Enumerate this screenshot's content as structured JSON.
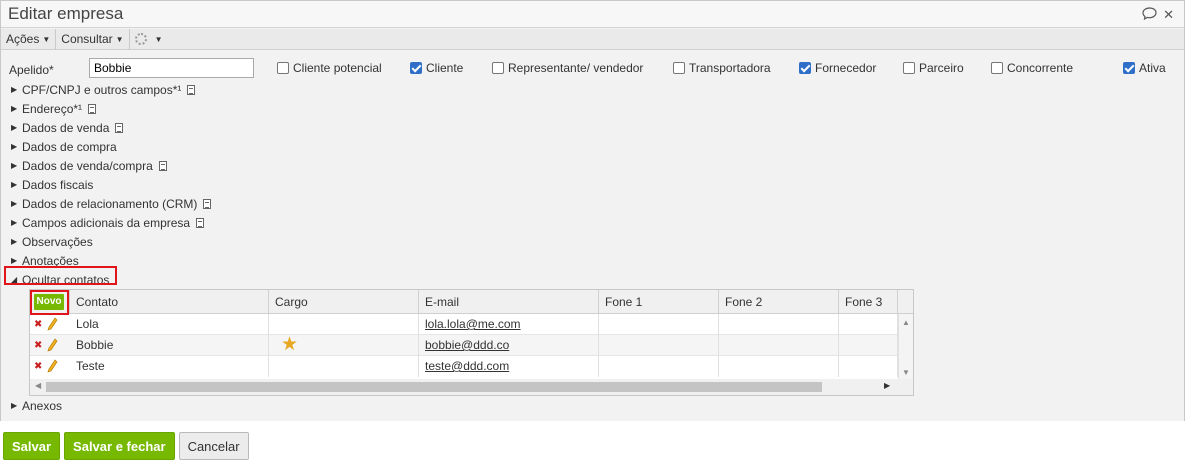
{
  "window": {
    "title": "Editar empresa"
  },
  "toolbar": {
    "acoes": "Ações",
    "consultar": "Consultar"
  },
  "form": {
    "apelido_label": "Apelido*",
    "apelido_value": "Bobbie",
    "checkboxes": [
      {
        "label": "Cliente potencial",
        "checked": false
      },
      {
        "label": "Cliente",
        "checked": true
      },
      {
        "label": "Representante/ vendedor",
        "checked": false
      },
      {
        "label": "Transportadora",
        "checked": false
      },
      {
        "label": "Fornecedor",
        "checked": true
      },
      {
        "label": "Parceiro",
        "checked": false
      },
      {
        "label": "Concorrente",
        "checked": false
      },
      {
        "label": "Ativa",
        "checked": true
      }
    ],
    "sections": [
      {
        "label": "CPF/CNPJ e outros campos*¹"
      },
      {
        "label": "Endereço*¹"
      },
      {
        "label": "Dados de venda"
      },
      {
        "label": "Dados de compra"
      },
      {
        "label": "Dados de venda/compra"
      },
      {
        "label": "Dados fiscais"
      },
      {
        "label": "Dados de relacionamento (CRM)"
      },
      {
        "label": "Campos adicionais da empresa"
      },
      {
        "label": "Observações"
      },
      {
        "label": "Anotações"
      },
      {
        "label": "Ocultar contatos"
      }
    ],
    "anexos": "Anexos"
  },
  "contacts": {
    "new_label": "Novo",
    "columns": [
      "Contato",
      "Cargo",
      "E-mail",
      "Fone 1",
      "Fone 2",
      "Fone 3"
    ],
    "rows": [
      {
        "contato": "Lola",
        "cargo": "",
        "email": "lola.lola@me.com",
        "fone1": "",
        "fone2": "",
        "fone3": "",
        "primary": false
      },
      {
        "contato": "Bobbie",
        "cargo": "",
        "email": "bobbie@ddd.co",
        "fone1": "",
        "fone2": "",
        "fone3": "",
        "primary": true
      },
      {
        "contato": "Teste",
        "cargo": "",
        "email": "teste@ddd.com",
        "fone1": "",
        "fone2": "",
        "fone3": "",
        "primary": false
      }
    ]
  },
  "footer": {
    "save": "Salvar",
    "save_close": "Salvar e fechar",
    "cancel": "Cancelar"
  },
  "colors": {
    "accent_green": "#76b900",
    "highlight_red": "#e0141b",
    "check_blue": "#2f6fc7",
    "star": "#e8a822"
  },
  "icons": [
    "comment-icon",
    "close-icon",
    "gear-icon",
    "document-icon",
    "delete-icon",
    "edit-pencil-icon",
    "star-icon"
  ]
}
